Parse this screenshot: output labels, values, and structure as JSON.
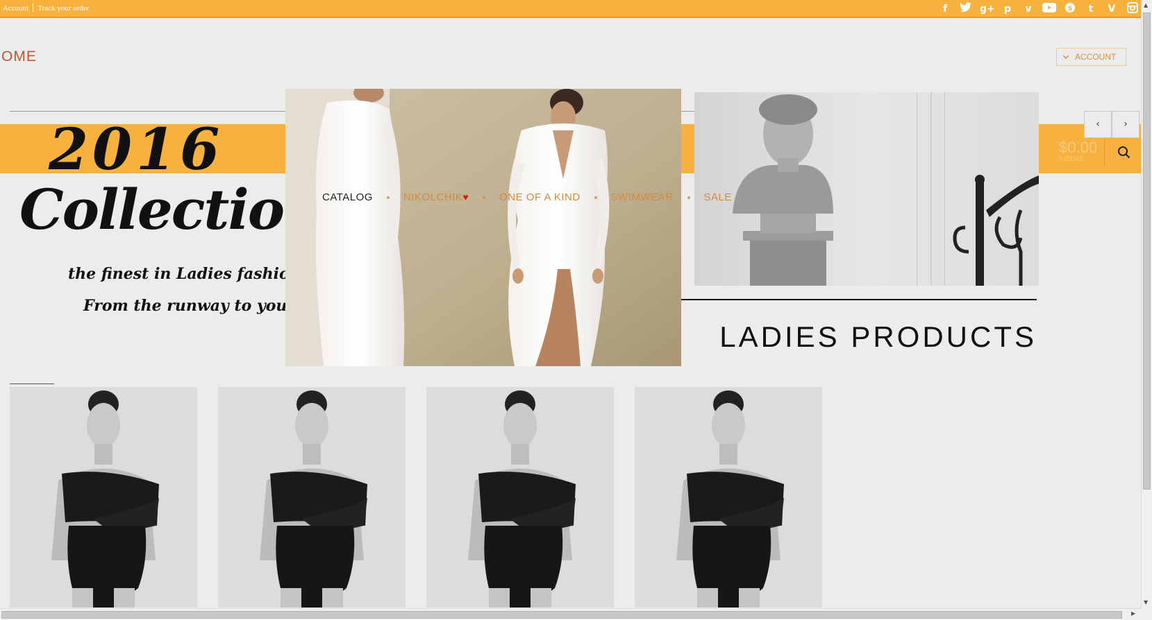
{
  "topbar": {
    "links": [
      "Account",
      "Track your order"
    ],
    "social_icons": [
      "facebook-icon",
      "twitter-icon",
      "google-plus-icon",
      "pinterest-icon",
      "vimeo-icon",
      "youtube-icon",
      "skype-icon",
      "tumblr-icon",
      "vine-icon",
      "instagram-icon"
    ]
  },
  "header": {
    "home_label": "OME",
    "account_label": "ACCOUNT"
  },
  "hero": {
    "year": "2016",
    "headline": "Collection",
    "tagline_1": "the finest in Ladies fashion",
    "tagline_2": "From the runway to you"
  },
  "cart": {
    "total": "$0.00",
    "items": "0 ITEMS"
  },
  "nav": {
    "items": [
      "CATALOG",
      "NIKOLCHIK",
      "ONE OF A KIND",
      "SWIMWEAR",
      "SALE"
    ],
    "heart_glyph": "♥"
  },
  "section": {
    "title": "LADIES PRODUCTS"
  },
  "colors": {
    "accent": "#f6b13e",
    "nav_link": "#d48a3d",
    "home_link": "#b45a37"
  }
}
